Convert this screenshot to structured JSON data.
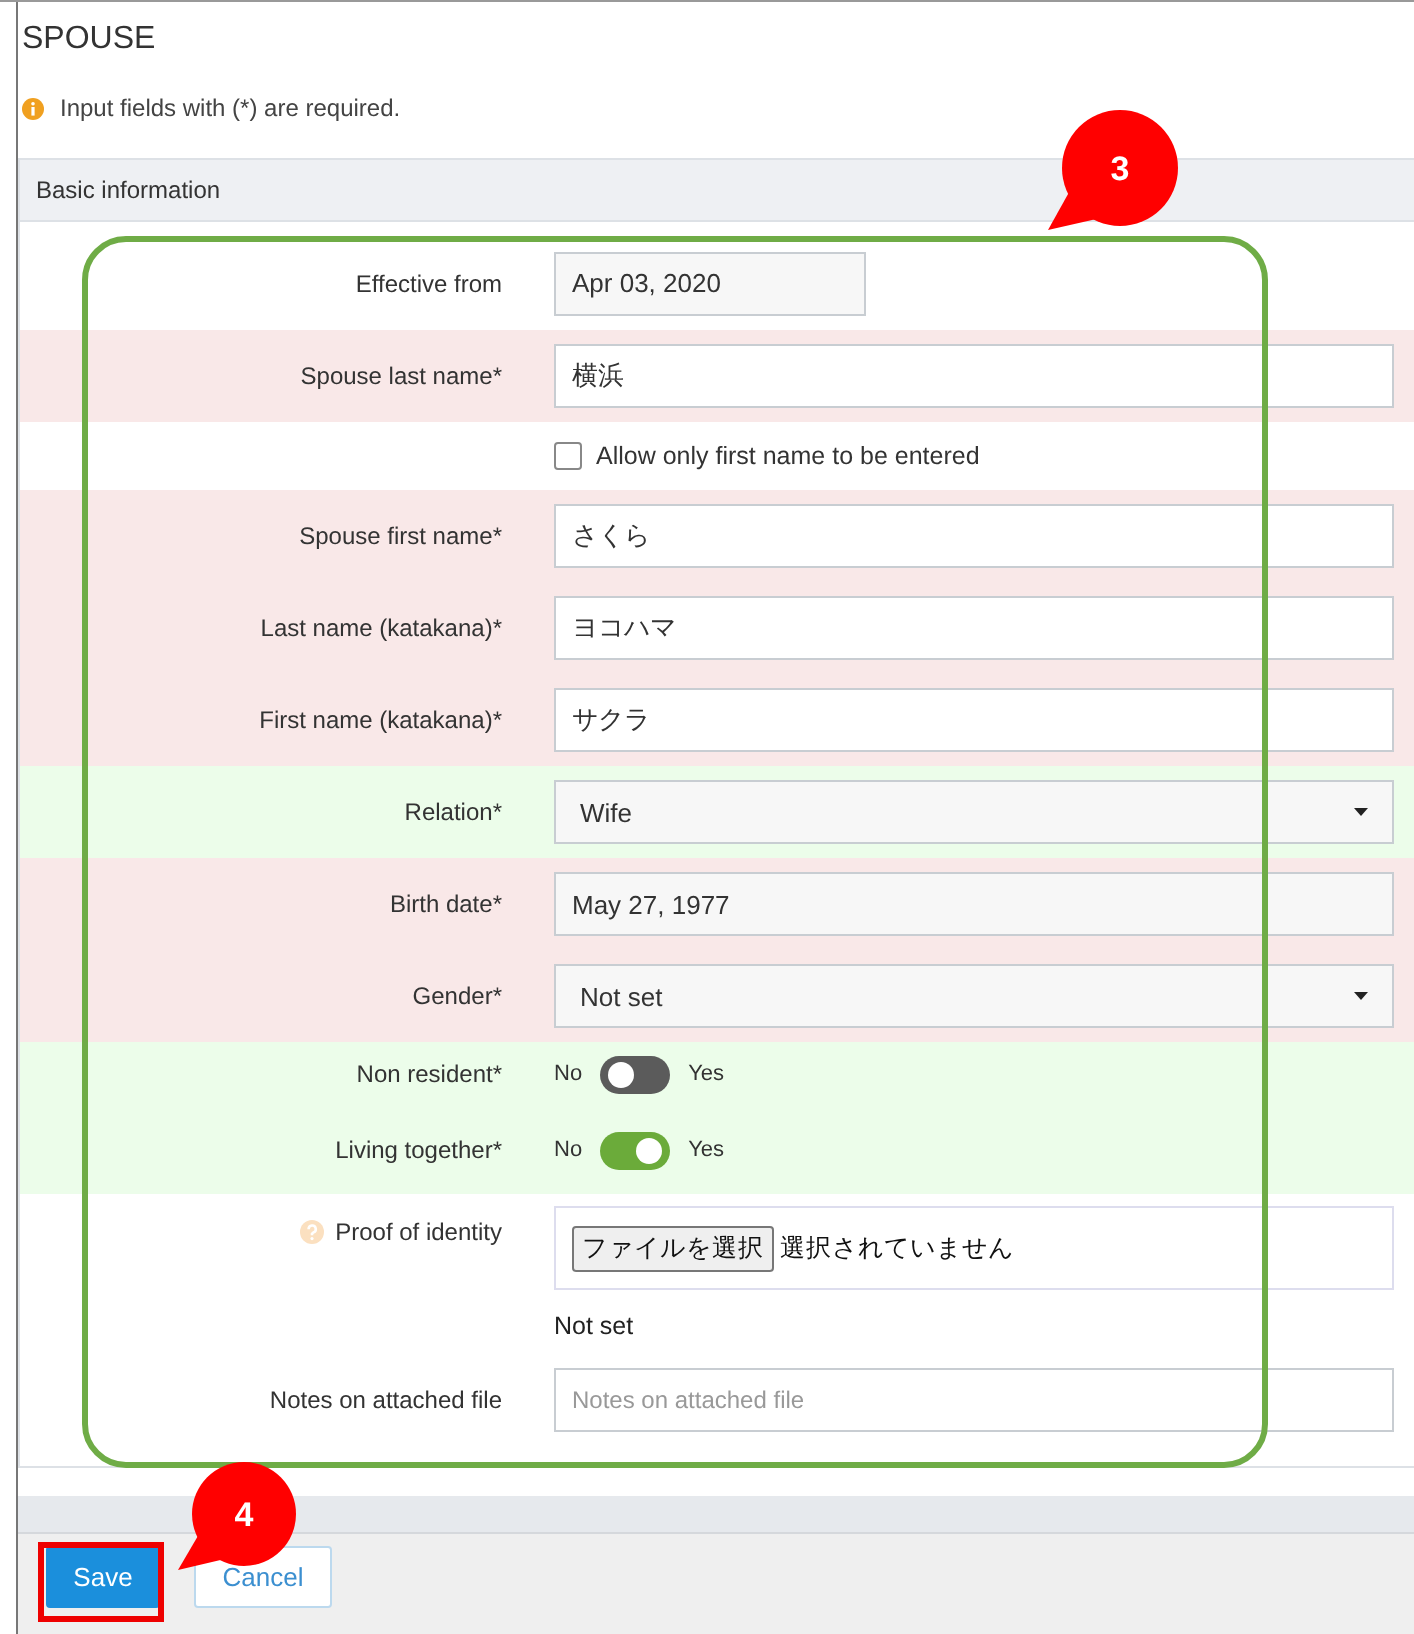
{
  "title": "SPOUSE",
  "notice": "Input fields with (*) are required.",
  "section": "Basic information",
  "rows": [
    {
      "kind": "date_short",
      "label": "Effective from",
      "value": "Apr 03, 2020"
    },
    {
      "kind": "text",
      "label": "Spouse last name*",
      "value": "横浜",
      "color": "#f9e8e8"
    },
    {
      "kind": "checkbox",
      "text": "Allow only first name to be entered",
      "checked": false
    },
    {
      "kind": "text",
      "label": "Spouse first name*",
      "value": "さくら",
      "color": "#f9e8e8"
    },
    {
      "kind": "text",
      "label": "Last name (katakana)*",
      "value": "ヨコハマ",
      "color": "#f9e8e8"
    },
    {
      "kind": "text",
      "label": "First name (katakana)*",
      "value": "サクラ",
      "color": "#f9e8e8"
    },
    {
      "kind": "select",
      "label": "Relation*",
      "value": "Wife",
      "color": "#ecfdea"
    },
    {
      "kind": "date",
      "label": "Birth date*",
      "value": "May 27, 1977",
      "color": "#f9e8e8"
    },
    {
      "kind": "select",
      "label": "Gender*",
      "value": "Not set",
      "color": "#f9e8e8"
    },
    {
      "kind": "toggle",
      "label": "Non resident*",
      "off_text": "No",
      "on_text": "Yes",
      "on": false,
      "color": "#ecfdea"
    },
    {
      "kind": "toggle",
      "label": "Living together*",
      "off_text": "No",
      "on_text": "Yes",
      "on": true,
      "color": "#ecfdea"
    },
    {
      "kind": "file",
      "label": "Proof of identity",
      "button": "ファイルを選択",
      "file_status": "選択されていません"
    },
    {
      "kind": "note",
      "value": "Not set"
    },
    {
      "kind": "text",
      "label": "Notes on attached file",
      "placeholder": "Notes on attached file"
    }
  ],
  "buttons": [
    {
      "label": "Save",
      "kind": "primary"
    },
    {
      "label": "Cancel",
      "kind": "secondary"
    }
  ],
  "annotations": [
    {
      "kind": "callout",
      "text": "3"
    },
    {
      "kind": "callout",
      "text": "4"
    }
  ]
}
